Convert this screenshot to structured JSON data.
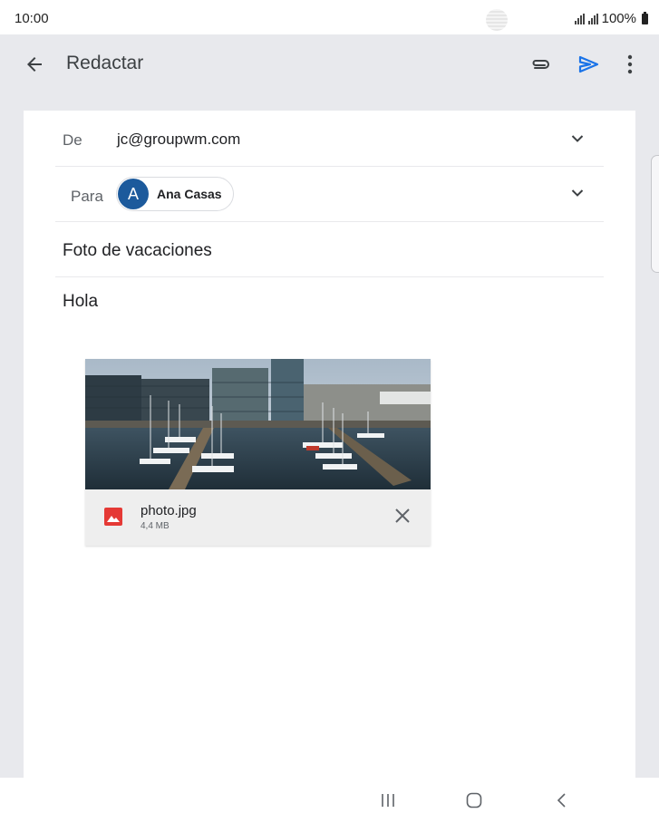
{
  "status_bar": {
    "time": "10:00",
    "battery_text": "100%"
  },
  "app_bar": {
    "title": "Redactar",
    "icons": [
      "back-arrow-icon",
      "paperclip-icon",
      "send-icon",
      "more-vert-icon"
    ],
    "send_color": "#1a73e8"
  },
  "compose": {
    "from_label": "De",
    "from_value": "jc@groupwm.com",
    "to_label": "Para",
    "recipient": {
      "initial": "A",
      "name": "Ana Casas",
      "avatar_color": "#1c5a9c"
    },
    "subject": "Foto de vacaciones",
    "body": "Hola"
  },
  "attachment": {
    "file_name": "photo.jpg",
    "file_size": "4,4 MB",
    "icon": "image-file-icon",
    "icon_color": "#e53935"
  },
  "nav_bar": {
    "icons": [
      "recents-icon",
      "home-icon",
      "back-icon"
    ]
  }
}
